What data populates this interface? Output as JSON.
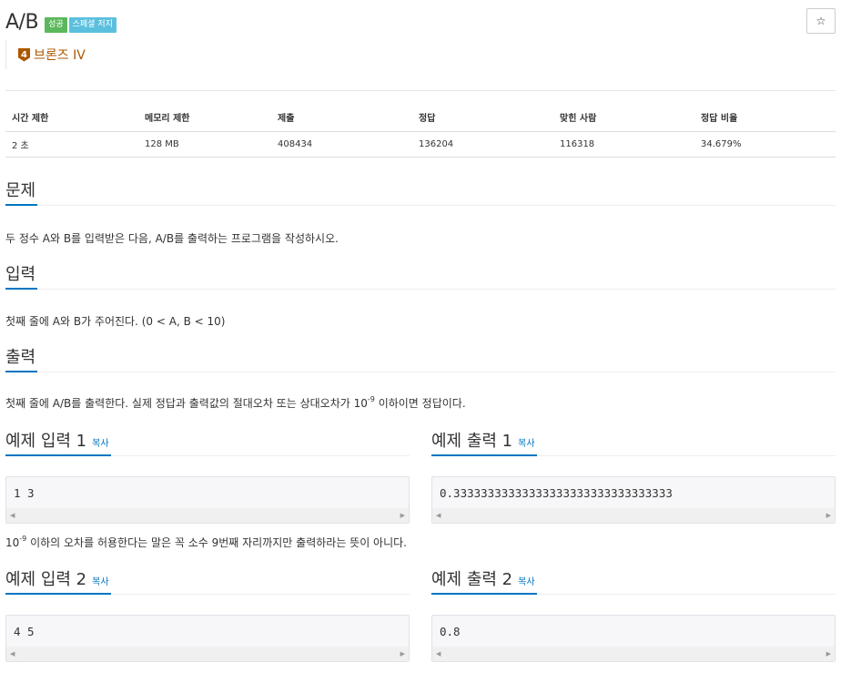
{
  "problem": {
    "title": "A/B",
    "badges": [
      "성공",
      "스페셜 저지"
    ],
    "star_label": "☆",
    "tier": {
      "number": "4",
      "label": "브론즈 IV",
      "color": "#ad5600"
    }
  },
  "info_table": {
    "headers": [
      "시간 제한",
      "메모리 제한",
      "제출",
      "정답",
      "맞힌 사람",
      "정답 비율"
    ],
    "values": [
      "2 초",
      "128 MB",
      "408434",
      "136204",
      "116318",
      "34.679%"
    ]
  },
  "sections": {
    "problem": {
      "heading": "문제",
      "text": "두 정수 A와 B를 입력받은 다음, A/B를 출력하는 프로그램을 작성하시오."
    },
    "input": {
      "heading": "입력",
      "text": "첫째 줄에 A와 B가 주어진다. (0 < A, B < 10)"
    },
    "output": {
      "heading": "출력",
      "text_before": "첫째 줄에 A/B를 출력한다. 실제 정답과 출력값의 절대오차 또는 상대오차가 10",
      "text_sup": "-9",
      "text_after": " 이하이면 정답이다."
    }
  },
  "samples": [
    {
      "input_heading": "예제 입력 1",
      "output_heading": "예제 출력 1",
      "copy_label": "복사",
      "input": "1 3",
      "output": "0.33333333333333333333333333333333"
    },
    {
      "input_heading": "예제 입력 2",
      "output_heading": "예제 출력 2",
      "copy_label": "복사",
      "input": "4 5",
      "output": "0.8"
    }
  ],
  "sample_note": {
    "base": "10",
    "sup": "-9",
    "text": " 이하의 오차를 허용한다는 말은 꼭 소수 9번째 자리까지만 출력하라는 뜻이 아니다."
  },
  "colors": {
    "accent": "#0076c0",
    "success_badge": "#5cb85c",
    "info_badge": "#5bc0de",
    "bronze": "#ad5600"
  }
}
